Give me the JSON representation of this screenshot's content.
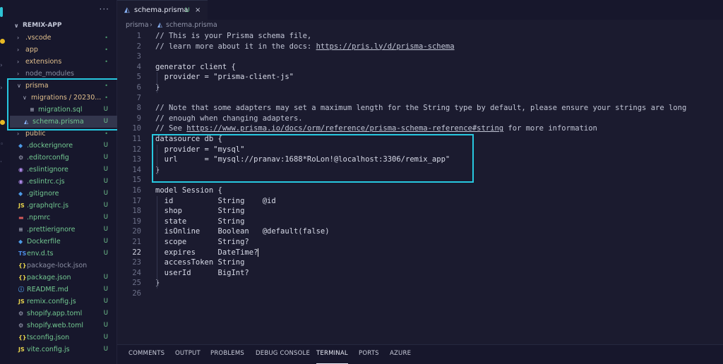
{
  "app": {
    "brand_color": "#27c8e0",
    "status_colors": {
      "untracked": "#73c991",
      "modified": "#e2c08d"
    }
  },
  "activity_bar": {
    "icons": [
      "files-icon",
      "search-icon",
      "source-control-icon",
      "run-icon",
      "extensions-icon"
    ]
  },
  "sidebar": {
    "more_label": "···",
    "project": "REMIX-APP",
    "items": [
      {
        "label": ".vscode",
        "type": "folder",
        "status": "•",
        "depth": 0,
        "open": false
      },
      {
        "label": "app",
        "type": "folder",
        "status": "•",
        "depth": 0,
        "open": false
      },
      {
        "label": "extensions",
        "type": "folder",
        "status": "•",
        "depth": 0,
        "open": false
      },
      {
        "label": "node_modules",
        "type": "folder",
        "status": "",
        "depth": 0,
        "open": false
      },
      {
        "label": "prisma",
        "type": "folder",
        "status": "•",
        "depth": 0,
        "open": true
      },
      {
        "label": "migrations / 20230...",
        "type": "folder",
        "status": "•",
        "depth": 1,
        "open": true
      },
      {
        "label": "migration.sql",
        "type": "file",
        "icon": "≡",
        "status": "U",
        "depth": 2
      },
      {
        "label": "schema.prisma",
        "type": "file",
        "icon": "◭",
        "status": "U",
        "depth": 1,
        "selected": true
      },
      {
        "label": "public",
        "type": "folder",
        "status": "•",
        "depth": 0,
        "open": false
      },
      {
        "label": ".dockerignore",
        "type": "file",
        "icon": "◆",
        "status": "U",
        "depth": 0
      },
      {
        "label": ".editorconfig",
        "type": "file",
        "icon": "⚙",
        "status": "U",
        "depth": 0
      },
      {
        "label": ".eslintignore",
        "type": "file",
        "icon": "◉",
        "status": "U",
        "depth": 0
      },
      {
        "label": ".eslintrc.cjs",
        "type": "file",
        "icon": "◉",
        "status": "U",
        "depth": 0
      },
      {
        "label": ".gitignore",
        "type": "file",
        "icon": "◆",
        "status": "U",
        "depth": 0
      },
      {
        "label": ".graphqlrc.js",
        "type": "file",
        "icon": "JS",
        "status": "U",
        "depth": 0
      },
      {
        "label": ".npmrc",
        "type": "file",
        "icon": "▬",
        "status": "U",
        "depth": 0
      },
      {
        "label": ".prettierignore",
        "type": "file",
        "icon": "≡",
        "status": "U",
        "depth": 0
      },
      {
        "label": "Dockerfile",
        "type": "file",
        "icon": "◆",
        "status": "U",
        "depth": 0
      },
      {
        "label": "env.d.ts",
        "type": "file",
        "icon": "TS",
        "status": "U",
        "depth": 0
      },
      {
        "label": "package-lock.json",
        "type": "file",
        "icon": "{}",
        "status": "",
        "depth": 0
      },
      {
        "label": "package.json",
        "type": "file",
        "icon": "{}",
        "status": "U",
        "depth": 0
      },
      {
        "label": "README.md",
        "type": "file",
        "icon": "ⓘ",
        "status": "U",
        "depth": 0
      },
      {
        "label": "remix.config.js",
        "type": "file",
        "icon": "JS",
        "status": "U",
        "depth": 0
      },
      {
        "label": "shopify.app.toml",
        "type": "file",
        "icon": "⚙",
        "status": "U",
        "depth": 0
      },
      {
        "label": "shopify.web.toml",
        "type": "file",
        "icon": "⚙",
        "status": "U",
        "depth": 0
      },
      {
        "label": "tsconfig.json",
        "type": "file",
        "icon": "{}",
        "status": "U",
        "depth": 0
      },
      {
        "label": "vite.config.js",
        "type": "file",
        "icon": "JS",
        "status": "U",
        "depth": 0
      }
    ]
  },
  "editor": {
    "tab": {
      "label": "schema.prisma",
      "badge": "U",
      "close": "×"
    },
    "breadcrumb": {
      "folder": "prisma",
      "separator": "›",
      "file": "schema.prisma"
    },
    "current_line": 22,
    "lines": [
      {
        "n": "1",
        "text": "// This is your Prisma schema file,",
        "kind": "comment"
      },
      {
        "n": "2",
        "text": "// learn more about it in the docs: ",
        "link": "https://pris.ly/d/prisma-schema",
        "kind": "comment"
      },
      {
        "n": "3",
        "text": "",
        "kind": "code"
      },
      {
        "n": "4",
        "text": "generator client {",
        "kind": "code"
      },
      {
        "n": "5",
        "text": "  provider = \"prisma-client-js\"",
        "kind": "code"
      },
      {
        "n": "6",
        "text": "}",
        "kind": "code"
      },
      {
        "n": "7",
        "text": "",
        "kind": "code"
      },
      {
        "n": "8",
        "text": "// Note that some adapters may set a maximum length for the String type by default, please ensure your strings are long",
        "kind": "comment"
      },
      {
        "n": "9",
        "text": "// enough when changing adapters.",
        "kind": "comment"
      },
      {
        "n": "10",
        "text": "// See ",
        "link": "https://www.prisma.io/docs/orm/reference/prisma-schema-reference#string",
        "after": " for more information",
        "kind": "comment"
      },
      {
        "n": "11",
        "text": "datasource db {",
        "kind": "code"
      },
      {
        "n": "12",
        "text": "  provider = \"mysql\"",
        "kind": "code"
      },
      {
        "n": "13",
        "text": "  url      = \"mysql://pranav:1688*RoLon!@localhost:3306/remix_app\"",
        "kind": "code"
      },
      {
        "n": "14",
        "text": "}",
        "kind": "code"
      },
      {
        "n": "15",
        "text": "",
        "kind": "code"
      },
      {
        "n": "16",
        "text": "model Session {",
        "kind": "code"
      },
      {
        "n": "17",
        "text": "  id          String    @id",
        "kind": "code"
      },
      {
        "n": "18",
        "text": "  shop        String",
        "kind": "code"
      },
      {
        "n": "19",
        "text": "  state       String",
        "kind": "code"
      },
      {
        "n": "20",
        "text": "  isOnline    Boolean   @default(false)",
        "kind": "code"
      },
      {
        "n": "21",
        "text": "  scope       String?",
        "kind": "code"
      },
      {
        "n": "22",
        "text": "  expires     DateTime?",
        "kind": "code"
      },
      {
        "n": "23",
        "text": "  accessToken String",
        "kind": "code"
      },
      {
        "n": "24",
        "text": "  userId      BigInt?",
        "kind": "code"
      },
      {
        "n": "25",
        "text": "}",
        "kind": "code"
      },
      {
        "n": "26",
        "text": "",
        "kind": "code"
      }
    ]
  },
  "panel": {
    "tabs": [
      "COMMENTS",
      "OUTPUT",
      "PROBLEMS",
      "DEBUG CONSOLE",
      "TERMINAL",
      "PORTS",
      "AZURE"
    ],
    "active": "TERMINAL"
  }
}
